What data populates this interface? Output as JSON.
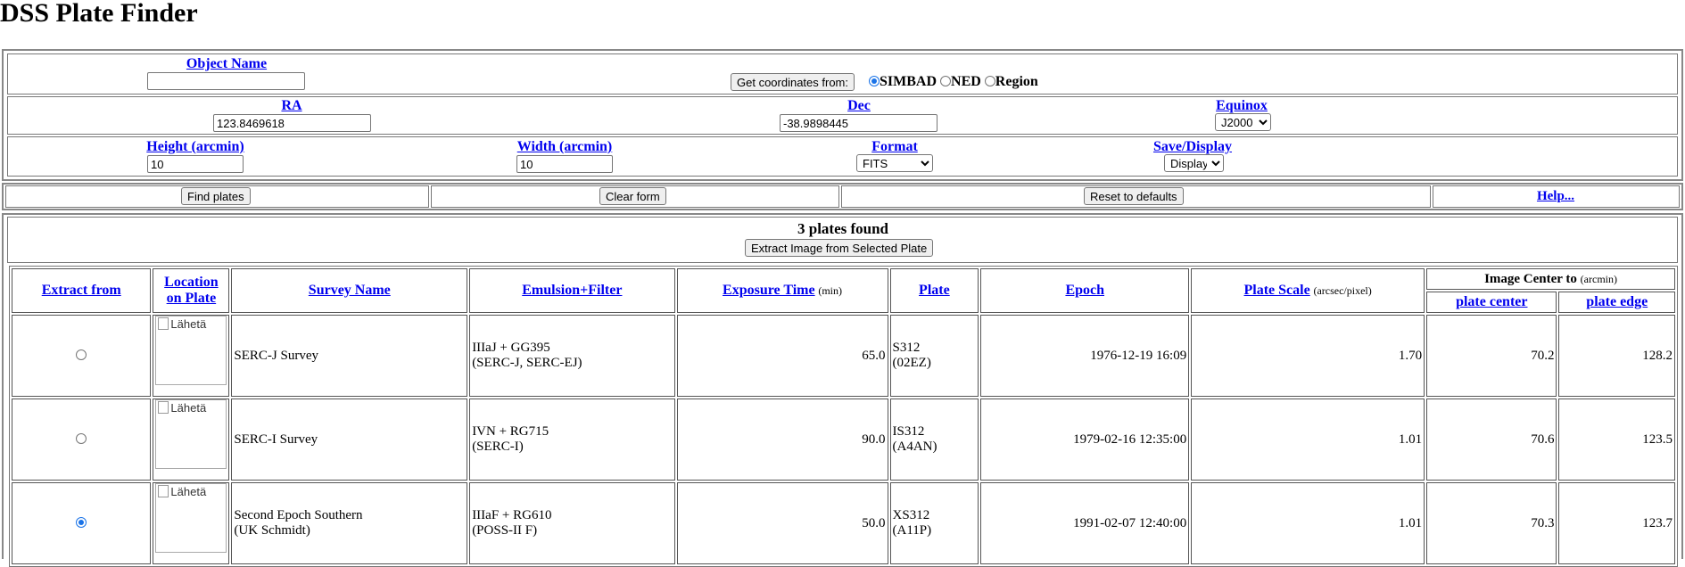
{
  "page": {
    "title": "DSS Plate Finder"
  },
  "form": {
    "object_name_label": "Object Name",
    "object_name_value": "",
    "get_coords_button": "Get coordinates from:",
    "resolvers": [
      {
        "label": "SIMBAD",
        "checked": true
      },
      {
        "label": "NED",
        "checked": false
      },
      {
        "label": "Region",
        "checked": false
      }
    ],
    "ra_label": "RA",
    "ra_value": "123.8469618",
    "dec_label": "Dec",
    "dec_value": "-38.9898445",
    "equinox_label": "Equinox",
    "equinox_value": "J2000",
    "height_label": "Height (arcmin)",
    "height_value": "10",
    "width_label": "Width (arcmin)",
    "width_value": "10",
    "format_label": "Format",
    "format_value": "FITS",
    "save_label": "Save/Display",
    "save_value": "Display"
  },
  "actions": {
    "find": "Find plates",
    "clear": "Clear form",
    "reset": "Reset to defaults",
    "help": "Help..."
  },
  "results": {
    "count_text": "3 plates found",
    "extract_button": "Extract Image from Selected Plate",
    "headers": {
      "extract": "Extract from",
      "location_1": "Location",
      "location_2": "on Plate",
      "survey": "Survey Name",
      "emulsion": "Emulsion+Filter",
      "exposure": "Exposure Time",
      "exposure_unit": "(min)",
      "plate": "Plate",
      "epoch": "Epoch",
      "scale": "Plate Scale",
      "scale_unit": "(arcsec/pixel)",
      "image_center": "Image Center to",
      "image_center_unit": "(arcmin)",
      "plate_center": "plate center",
      "plate_edge": "plate edge"
    },
    "thumb_alt": "Lähetä",
    "rows": [
      {
        "selected": false,
        "survey_1": "SERC-J Survey",
        "survey_2": "",
        "emulsion_1": "IIIaJ + GG395",
        "emulsion_2": "(SERC-J, SERC-EJ)",
        "exposure": "65.0",
        "plate_1": "S312",
        "plate_2": "(02EZ)",
        "epoch": "1976-12-19 16:09",
        "scale": "1.70",
        "center": "70.2",
        "edge": "128.2"
      },
      {
        "selected": false,
        "survey_1": "SERC-I Survey",
        "survey_2": "",
        "emulsion_1": "IVN + RG715",
        "emulsion_2": "(SERC-I)",
        "exposure": "90.0",
        "plate_1": "IS312",
        "plate_2": "(A4AN)",
        "epoch": "1979-02-16 12:35:00",
        "scale": "1.01",
        "center": "70.6",
        "edge": "123.5"
      },
      {
        "selected": true,
        "survey_1": "Second Epoch Southern",
        "survey_2": "(UK Schmidt)",
        "emulsion_1": "IIIaF + RG610",
        "emulsion_2": "(POSS-II F)",
        "exposure": "50.0",
        "plate_1": "XS312",
        "plate_2": "(A11P)",
        "epoch": "1991-02-07 12:40:00",
        "scale": "1.01",
        "center": "70.3",
        "edge": "123.7"
      }
    ]
  }
}
